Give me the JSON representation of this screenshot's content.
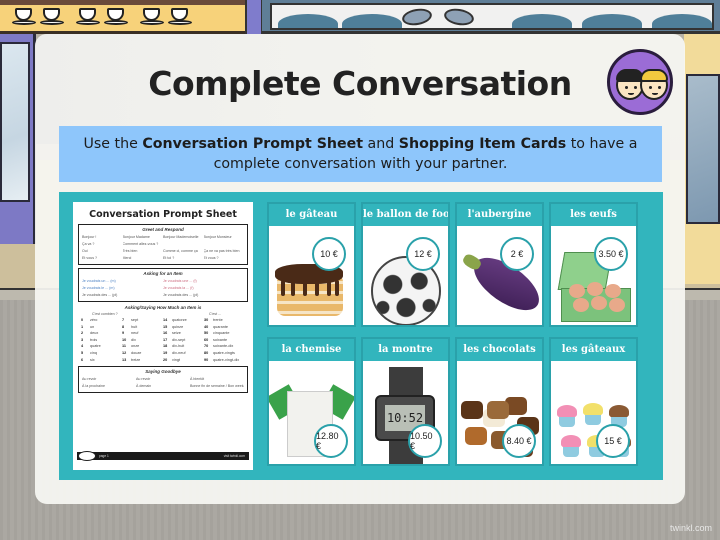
{
  "slide": {
    "title": "Complete Conversation",
    "instruction": {
      "part1": "Use the ",
      "bold1": "Conversation Prompt Sheet",
      "part2": " and ",
      "bold2": "Shopping Item Cards",
      "part3": " to have a complete conversation with your partner."
    },
    "watermark": "twinkl.com"
  },
  "prompt_sheet": {
    "title": "Conversation Prompt Sheet",
    "greet": {
      "heading": "Greet and Respond",
      "rows": [
        [
          "Bonjour !",
          "Bonjour Madame",
          "Bonjour Mademoiselle",
          "Bonjour Monsieur"
        ],
        [
          "Ça va ?",
          "Comment allez-vous ?",
          "",
          ""
        ],
        [
          "Oui",
          "Très bien",
          "Comme ci, comme ça",
          "Ça ne va pas très bien"
        ],
        [
          "Et vous ?",
          "Merci",
          "Et toi ?",
          "Et vous ?"
        ]
      ]
    },
    "asking": {
      "heading": "Asking for an Item",
      "rows": [
        [
          "Je voudrais un ... (m)",
          "Je voudrais une ... (f)"
        ],
        [
          "Je voudrais le ... (m)",
          "Je voudrais la ... (f)"
        ],
        [
          "Je voudrais des ... (pl)",
          "Je voudrais des ... (pl)"
        ]
      ]
    },
    "how_much": {
      "heading": "Asking/Saying How Much an Item is",
      "left_label": "C'est combien ?",
      "right_label": "C'est ...",
      "numbers": [
        [
          "0",
          "zéro"
        ],
        [
          "7",
          "sept"
        ],
        [
          "14",
          "quatorze"
        ],
        [
          "30",
          "trente"
        ],
        [
          "1",
          "un"
        ],
        [
          "8",
          "huit"
        ],
        [
          "15",
          "quinze"
        ],
        [
          "40",
          "quarante"
        ],
        [
          "2",
          "deux"
        ],
        [
          "9",
          "neuf"
        ],
        [
          "16",
          "seize"
        ],
        [
          "50",
          "cinquante"
        ],
        [
          "3",
          "trois"
        ],
        [
          "10",
          "dix"
        ],
        [
          "17",
          "dix-sept"
        ],
        [
          "60",
          "soixante"
        ],
        [
          "4",
          "quatre"
        ],
        [
          "11",
          "onze"
        ],
        [
          "18",
          "dix-huit"
        ],
        [
          "70",
          "soixante-dix"
        ],
        [
          "5",
          "cinq"
        ],
        [
          "12",
          "douze"
        ],
        [
          "19",
          "dix-neuf"
        ],
        [
          "80",
          "quatre-vingts"
        ],
        [
          "6",
          "six"
        ],
        [
          "13",
          "treize"
        ],
        [
          "20",
          "vingt"
        ],
        [
          "90",
          "quatre-vingt-dix"
        ]
      ]
    },
    "goodbye": {
      "heading": "Saying Goodbye",
      "rows": [
        [
          "Au revoir",
          "Au revoir",
          "À bientôt"
        ],
        [
          "À la prochaine",
          "À demain",
          "Bonne fin de semaine / Bon week-end"
        ]
      ]
    },
    "footer": {
      "left": "page 1",
      "right": "visit twinkl.com"
    }
  },
  "items": [
    {
      "name": "le gâteau",
      "price": "10 €",
      "art": "cake"
    },
    {
      "name": "le ballon de foot",
      "price": "12 €",
      "art": "football"
    },
    {
      "name": "l'aubergine",
      "price": "2 €",
      "art": "aubergine"
    },
    {
      "name": "les œufs",
      "price": "3.50 €",
      "art": "eggs"
    },
    {
      "name": "la chemise",
      "price": "12.80 €",
      "art": "shirt"
    },
    {
      "name": "la montre",
      "price": "10.50 €",
      "art": "watch",
      "watch_time": "10:52"
    },
    {
      "name": "les chocolats",
      "price": "8.40 €",
      "art": "chocolates"
    },
    {
      "name": "les gâteaux",
      "price": "15 €",
      "art": "cupcakes"
    }
  ],
  "colors": {
    "instruction_bg": "#8ec6fb",
    "frame_teal": "#32b5bd",
    "badge_purple": "#9b6cd6"
  }
}
